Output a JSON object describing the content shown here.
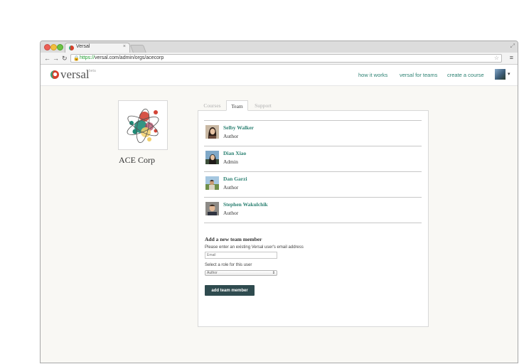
{
  "browser": {
    "tab_title": "Versal",
    "tab_close": "×",
    "url_scheme": "https://",
    "url_rest": "versal.com/admin/orgs/acecorp",
    "back": "←",
    "forward": "→",
    "reload": "↻",
    "lock": "🔒",
    "star": "☆",
    "menu": "≡",
    "fullscreen": "⤢"
  },
  "site": {
    "logo_text": "versal",
    "logo_beta": "beta",
    "nav": [
      "how it works",
      "versal for teams",
      "create a course"
    ],
    "caret": "▾"
  },
  "org": {
    "name": "ACE Corp"
  },
  "tabs": [
    "Courses",
    "Team",
    "Support"
  ],
  "active_tab": "Team",
  "team": [
    {
      "name": "Selby Walker",
      "role": "Author"
    },
    {
      "name": "Dian Xiao",
      "role": "Admin"
    },
    {
      "name": "Dan Garzi",
      "role": "Author"
    },
    {
      "name": "Stephen Wakulchik",
      "role": "Author"
    }
  ],
  "add_form": {
    "title": "Add a new team member",
    "email_label": "Please enter an existing Versal user's email address",
    "email_placeholder": "Email",
    "role_label": "Select a role for this user",
    "role_selected": "Author",
    "submit_label": "add team member"
  },
  "colors": {
    "accent": "#2d8273",
    "button": "#2f4b4f",
    "page_bg": "#f9f8f4"
  }
}
